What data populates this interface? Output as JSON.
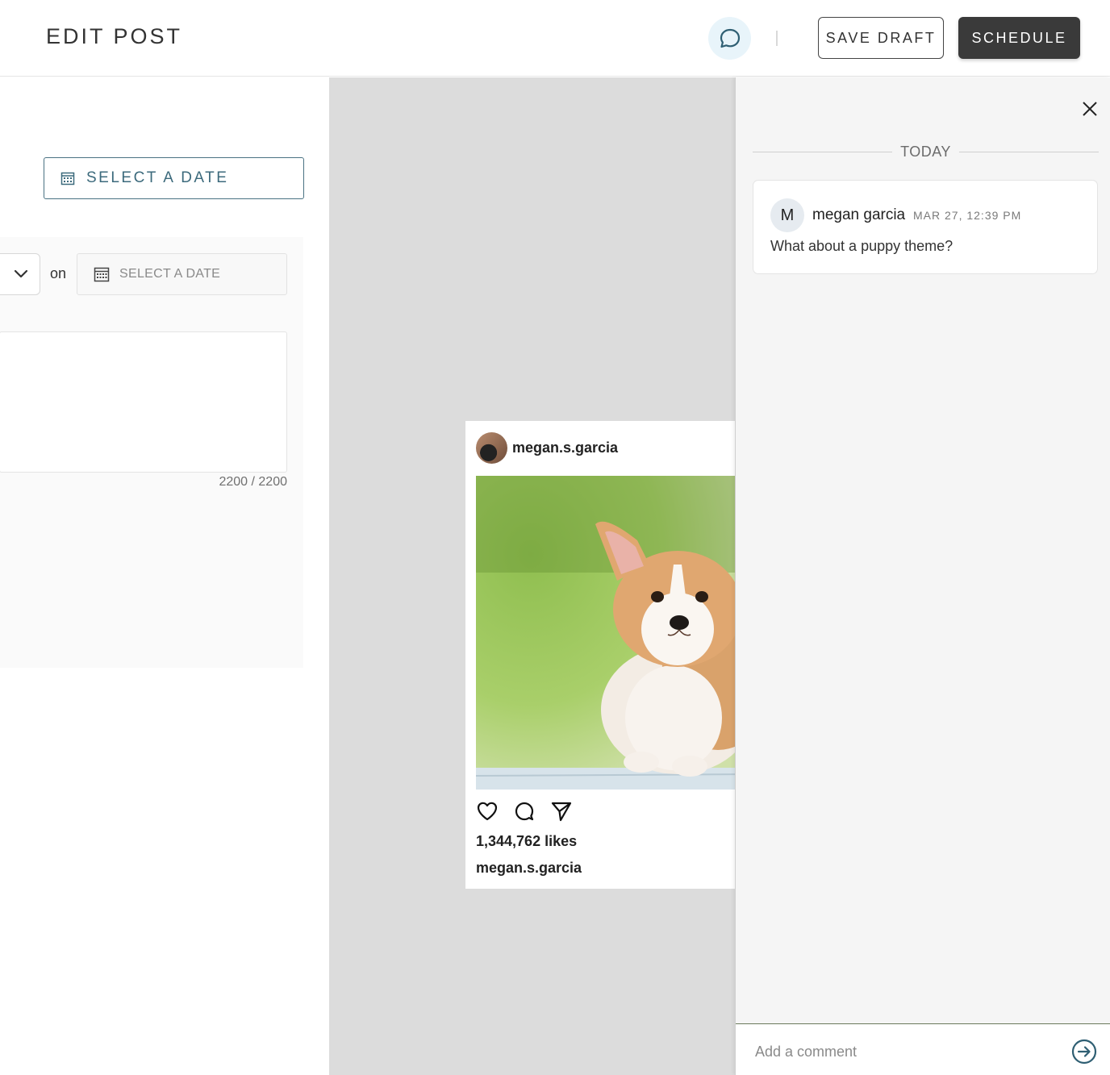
{
  "header": {
    "title": "EDIT POST",
    "save_draft_label": "SAVE DRAFT",
    "schedule_label": "SCHEDULE"
  },
  "left": {
    "select_date_label": "SELECT A DATE",
    "on_label": "on",
    "date_input_label": "SELECT A DATE",
    "char_count": "2200 / 2200"
  },
  "preview": {
    "username": "megan.s.garcia",
    "likes": "1,344,762 likes",
    "caption_username": "megan.s.garcia"
  },
  "comments": {
    "day_label": "TODAY",
    "items": [
      {
        "avatar_initial": "M",
        "author": "megan garcia",
        "time": "MAR 27, 12:39 PM",
        "text": "What about a puppy theme?"
      }
    ],
    "input_placeholder": "Add a comment"
  },
  "colors": {
    "accent": "#3c6a7c",
    "dark_button": "#3a3a3a",
    "toggle_bg": "#e8f4fa"
  },
  "icons": [
    "comment-bubble-icon",
    "calendar-icon",
    "chevron-down-icon",
    "heart-icon",
    "comment-icon",
    "send-icon",
    "close-icon",
    "arrow-right-circle-icon"
  ]
}
